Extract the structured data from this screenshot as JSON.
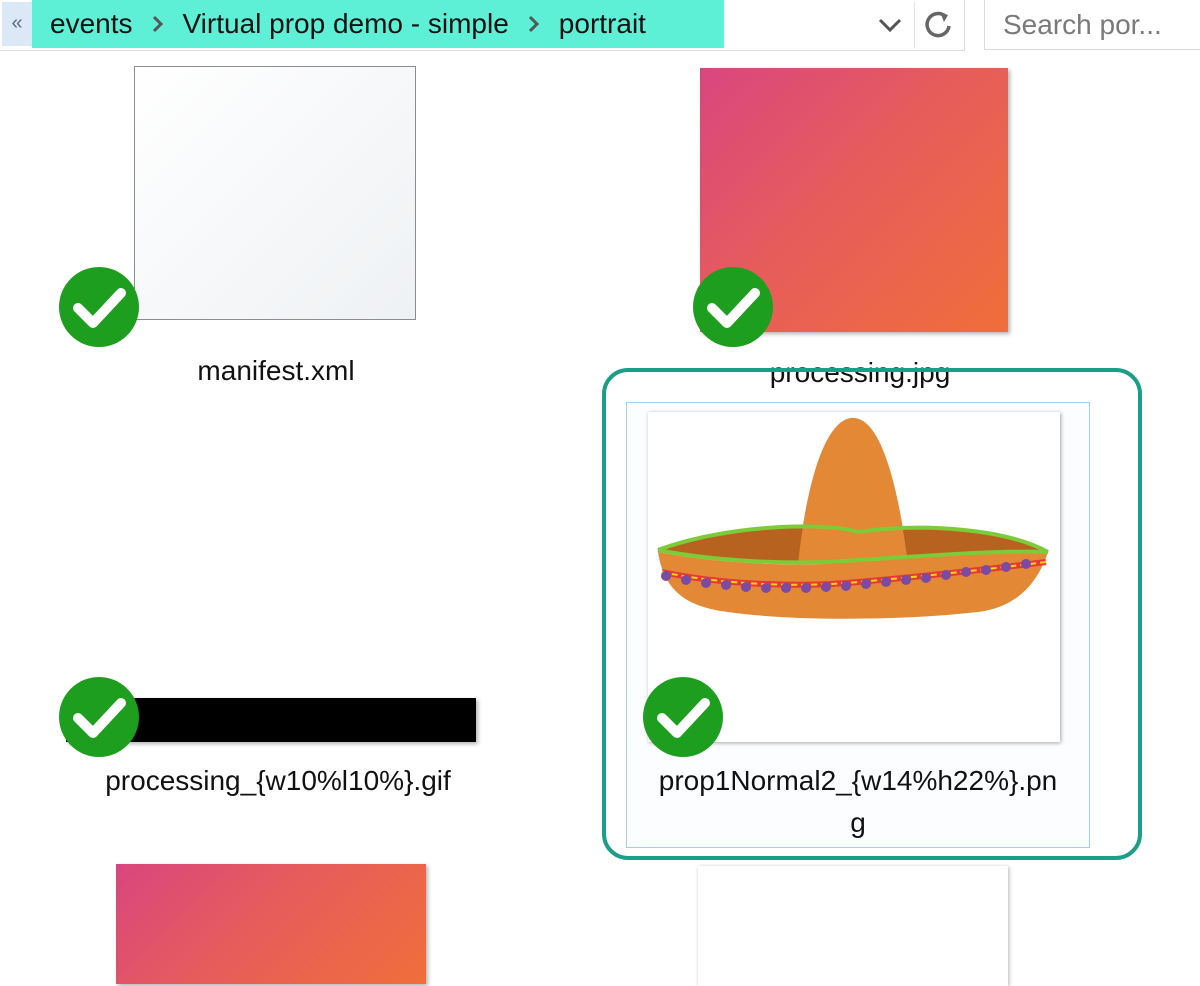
{
  "breadcrumb": {
    "up_glyph": "«",
    "items": [
      "events",
      "Virtual prop demo - simple",
      "portrait"
    ]
  },
  "search": {
    "placeholder": "Search por..."
  },
  "icons": {
    "separator": "chevron-right-icon",
    "dropdown": "chevron-down-icon",
    "refresh": "refresh-icon",
    "sync_status": "checkmark-icon"
  },
  "colors": {
    "breadcrumb_highlight": "#5ef0d6",
    "selection_ring": "#1a9e88",
    "check_green": "#1e9e1e"
  },
  "files": [
    {
      "name": "manifest.xml",
      "status": "synced"
    },
    {
      "name": "processing.jpg",
      "status": "synced"
    },
    {
      "name": "processing_{w10%l10%}.gif",
      "status": "synced"
    },
    {
      "name_line1": "prop1Normal2_{w14%h22%}.pn",
      "name_line2": "g",
      "status": "synced",
      "selected": true
    }
  ]
}
